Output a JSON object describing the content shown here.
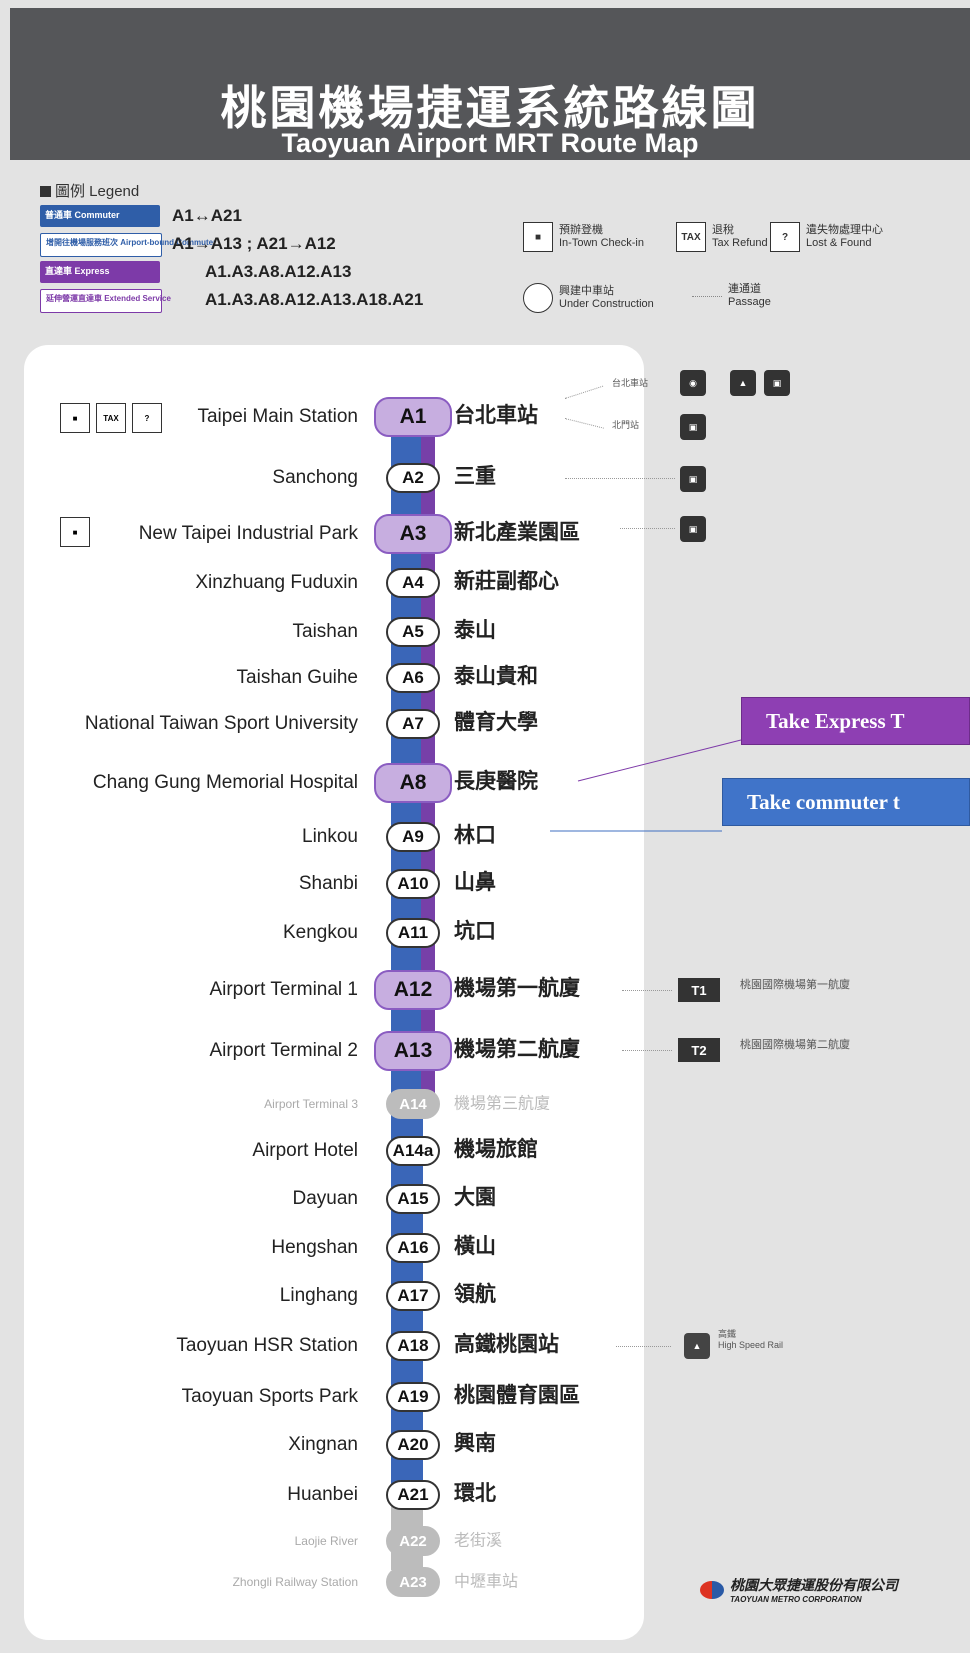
{
  "header": {
    "title_zh": "桃園機場捷運系統路線圖",
    "title_en": "Taoyuan Airport MRT Route Map"
  },
  "legend": {
    "title": "圖例 Legend",
    "rows": [
      {
        "label": "普通車 Commuter",
        "text": "A1↔A21",
        "color": "#2f5ea8"
      },
      {
        "label": "增開往機場服務班次 Airport-bound Commuter",
        "text": "A1→A13 ; A21→A12",
        "color": "#ffffff"
      },
      {
        "label": "直達車 Express",
        "text": "A1.A3.A8.A12.A13",
        "color": "#7d3aa8"
      },
      {
        "label": "延伸營運直達車 Extended Service",
        "text": "A1.A3.A8.A12.A13.A18.A21",
        "color": "#ffffff"
      }
    ],
    "services": [
      {
        "zh": "預辦登機",
        "en": "In-Town Check-in",
        "icon": "check-in-icon"
      },
      {
        "zh": "退稅",
        "en": "Tax Refund",
        "icon": "TAX"
      },
      {
        "zh": "遺失物處理中心",
        "en": "Lost & Found",
        "icon": "?"
      },
      {
        "zh": "興建中車站",
        "en": "Under Construction",
        "icon": "construction-icon"
      },
      {
        "zh": "連通道",
        "en": "Passage",
        "icon": "passage-line"
      }
    ]
  },
  "stations": [
    {
      "code": "A1",
      "en": "Taipei Main Station",
      "zh": "台北車站",
      "express": true
    },
    {
      "code": "A2",
      "en": "Sanchong",
      "zh": "三重",
      "express": false
    },
    {
      "code": "A3",
      "en": "New Taipei Industrial Park",
      "zh": "新北產業園區",
      "express": true
    },
    {
      "code": "A4",
      "en": "Xinzhuang Fuduxin",
      "zh": "新莊副都心",
      "express": false
    },
    {
      "code": "A5",
      "en": "Taishan",
      "zh": "泰山",
      "express": false
    },
    {
      "code": "A6",
      "en": "Taishan Guihe",
      "zh": "泰山貴和",
      "express": false
    },
    {
      "code": "A7",
      "en": "National Taiwan Sport University",
      "zh": "體育大學",
      "express": false
    },
    {
      "code": "A8",
      "en": "Chang Gung Memorial Hospital",
      "zh": "長庚醫院",
      "express": true
    },
    {
      "code": "A9",
      "en": "Linkou",
      "zh": "林口",
      "express": false
    },
    {
      "code": "A10",
      "en": "Shanbi",
      "zh": "山鼻",
      "express": false
    },
    {
      "code": "A11",
      "en": "Kengkou",
      "zh": "坑口",
      "express": false
    },
    {
      "code": "A12",
      "en": "Airport Terminal 1",
      "zh": "機場第一航廈",
      "express": true
    },
    {
      "code": "A13",
      "en": "Airport Terminal 2",
      "zh": "機場第二航廈",
      "express": true
    },
    {
      "code": "A14",
      "en": "Airport Terminal 3",
      "zh": "機場第三航廈",
      "express": false,
      "construction": true
    },
    {
      "code": "A14a",
      "en": "Airport Hotel",
      "zh": "機場旅館",
      "express": false
    },
    {
      "code": "A15",
      "en": "Dayuan",
      "zh": "大園",
      "express": false
    },
    {
      "code": "A16",
      "en": "Hengshan",
      "zh": "橫山",
      "express": false
    },
    {
      "code": "A17",
      "en": "Linghang",
      "zh": "領航",
      "express": false
    },
    {
      "code": "A18",
      "en": "Taoyuan HSR Station",
      "zh": "高鐵桃園站",
      "express": false
    },
    {
      "code": "A19",
      "en": "Taoyuan Sports Park",
      "zh": "桃園體育園區",
      "express": false
    },
    {
      "code": "A20",
      "en": "Xingnan",
      "zh": "興南",
      "express": false
    },
    {
      "code": "A21",
      "en": "Huanbei",
      "zh": "環北",
      "express": false
    },
    {
      "code": "A22",
      "en": "Laojie River",
      "zh": "老街溪",
      "express": false,
      "construction": true
    },
    {
      "code": "A23",
      "en": "Zhongli Railway Station",
      "zh": "中壢車站",
      "express": false,
      "construction": true
    }
  ],
  "connections": {
    "taipei_main": "台北車站",
    "beimen": "北門站",
    "terminal1_box": "T1",
    "terminal1_text": "桃園國際機場第一航廈",
    "terminal2_box": "T2",
    "terminal2_text": "桃園國際機場第二航廈",
    "hsr_zh": "高鐵",
    "hsr_en": "High Speed Rail"
  },
  "callouts": {
    "express": "Take Express T",
    "commuter": "Take commuter t"
  },
  "footer": {
    "company_zh": "桃園大眾捷運股份有限公司",
    "company_en": "TAOYUAN METRO CORPORATION"
  },
  "colors": {
    "express": "#7740a8",
    "commuter": "#3a66b8",
    "header": "#555659",
    "construction": "#bcbcbc"
  }
}
